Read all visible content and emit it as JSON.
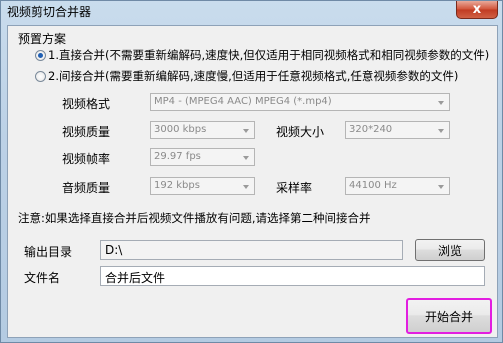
{
  "window": {
    "title": "视频剪切合并器",
    "close_label": "x"
  },
  "preset": {
    "group_title": "预置方案",
    "option1": "1.直接合并(不需要重新编解码,速度快,但仅适用于相同视频格式和相同视频参数的文件)",
    "option1_selected": true,
    "option2": "2.间接合并(需要重新编解码,速度慢,但适用于任意视频格式,任意视频参数的文件)",
    "option2_selected": false
  },
  "settings": {
    "video_format_label": "视频格式",
    "video_format_value": "MP4 - (MPEG4 AAC) MPEG4 (*.mp4)",
    "video_quality_label": "视频质量",
    "video_quality_value": "3000 kbps",
    "video_size_label": "视频大小",
    "video_size_value": "320*240",
    "frame_rate_label": "视频帧率",
    "frame_rate_value": "29.97 fps",
    "audio_quality_label": "音频质量",
    "audio_quality_value": "192 kbps",
    "sample_rate_label": "采样率",
    "sample_rate_value": "44100 Hz"
  },
  "note": "注意:如果选择直接合并后视频文件播放有问题,请选择第二种间接合并",
  "output": {
    "dir_label": "输出目录",
    "dir_value": "D:\\",
    "browse_label": "浏览",
    "filename_label": "文件名",
    "filename_value": "合并后文件"
  },
  "actions": {
    "start_label": "开始合并"
  }
}
